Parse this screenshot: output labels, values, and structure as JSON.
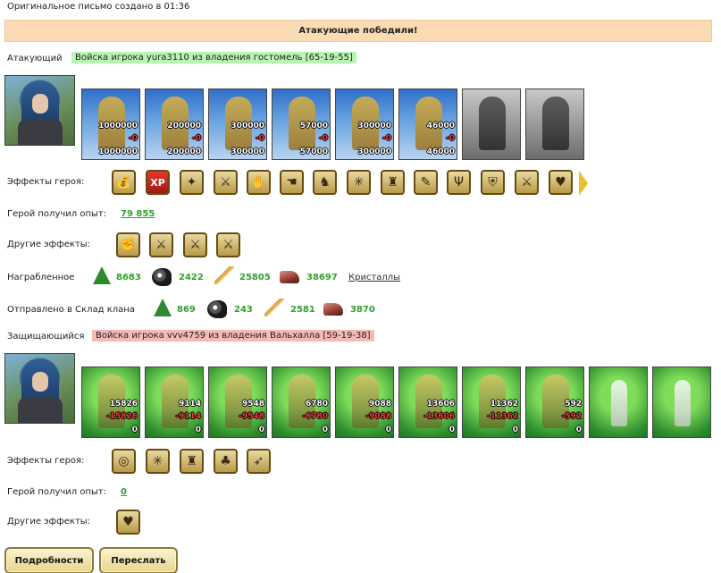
{
  "header": {
    "created": "Оригинальное письмо создано в 01:36",
    "banner": "Атакующие победили!"
  },
  "attacker": {
    "label": "Атакующий",
    "army": "Войска игрока yura3110 из владения гостомель [65-19-55]",
    "units": [
      {
        "count": "1000000",
        "loss": "-0",
        "remaining": "1000000"
      },
      {
        "count": "200000",
        "loss": "-0",
        "remaining": "200000"
      },
      {
        "count": "300000",
        "loss": "-0",
        "remaining": "300000"
      },
      {
        "count": "57000",
        "loss": "-0",
        "remaining": "57000"
      },
      {
        "count": "300000",
        "loss": "-0",
        "remaining": "300000"
      },
      {
        "count": "46000",
        "loss": "-0",
        "remaining": "46000"
      },
      {
        "count": "",
        "loss": "",
        "remaining": ""
      },
      {
        "count": "",
        "loss": "",
        "remaining": ""
      }
    ],
    "effects_label": "Эффекты героя:",
    "effects_icons": [
      "gold-pile-icon",
      "xp-icon",
      "xp-bonus-icon",
      "sword-icon",
      "handshake-icon",
      "hand-icon",
      "wolf-icon",
      "web-icon",
      "armor-icon",
      "quill-icon",
      "trident-icon",
      "shield-icon",
      "sword-flip-icon",
      "heart-icon"
    ],
    "xp_label": "Герой получил опыт:",
    "xp_value": "79 855",
    "other_effects_label": "Другие эффекты:",
    "other_effects_icons": [
      "fist-icon",
      "sword-icon",
      "sword-icon",
      "sword-icon"
    ],
    "plunder_label": "Награбленное",
    "plunder": [
      "8683",
      "2422",
      "25805",
      "38697"
    ],
    "crystals_link": "Кристаллы",
    "clan_label": "Отправлено в Склад клана",
    "clan": [
      "869",
      "243",
      "2581",
      "3870"
    ]
  },
  "defender": {
    "label": "Защищающийся",
    "army": "Войска игрока vvv4759 из владения Вальхалла [59-19-38]",
    "units": [
      {
        "count": "15826",
        "loss": "-15826",
        "remaining": "0"
      },
      {
        "count": "9114",
        "loss": "-9114",
        "remaining": "0"
      },
      {
        "count": "9548",
        "loss": "-9548",
        "remaining": "0"
      },
      {
        "count": "6780",
        "loss": "-6780",
        "remaining": "0"
      },
      {
        "count": "9088",
        "loss": "-9088",
        "remaining": "0"
      },
      {
        "count": "13606",
        "loss": "-13606",
        "remaining": "0"
      },
      {
        "count": "11362",
        "loss": "-11362",
        "remaining": "0"
      },
      {
        "count": "592",
        "loss": "-592",
        "remaining": "0"
      },
      {
        "count": "",
        "loss": "",
        "remaining": ""
      },
      {
        "count": "",
        "loss": "",
        "remaining": ""
      }
    ],
    "effects_label": "Эффекты героя:",
    "effects_icons": [
      "nest-icon",
      "web-icon",
      "armor-icon",
      "clover-icon",
      "bow-icon"
    ],
    "xp_label": "Герой получил опыт:",
    "xp_value": "0",
    "other_effects_label": "Другие эффекты:",
    "other_effects_icons": [
      "heart-swords-icon"
    ]
  },
  "buttons": {
    "details": "Подробности",
    "forward": "Переслать"
  }
}
